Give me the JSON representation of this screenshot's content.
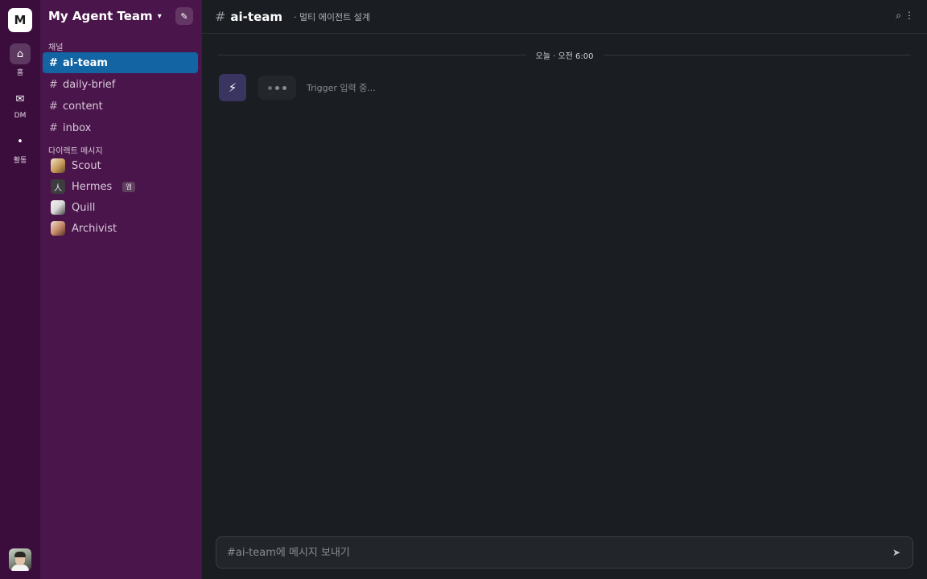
{
  "rail": {
    "workspace_initial": "M",
    "items": [
      {
        "icon": "home-icon",
        "glyph": "⌂",
        "label": "홈"
      },
      {
        "icon": "mail-icon",
        "glyph": "✉",
        "label": "DM"
      },
      {
        "icon": "activity-icon",
        "glyph": "•",
        "label": "활동"
      }
    ]
  },
  "sidebar": {
    "workspace_name": "My Agent Team",
    "caret": "▾",
    "compose_glyph": "✎",
    "channels_title": "채널",
    "channels": [
      {
        "hash": "#",
        "name": "ai-team"
      },
      {
        "hash": "#",
        "name": "daily-brief"
      },
      {
        "hash": "#",
        "name": "content"
      },
      {
        "hash": "#",
        "name": "inbox"
      }
    ],
    "dm_title": "다이렉트 메시지",
    "dms": [
      {
        "name": "Scout"
      },
      {
        "name": "Hermes",
        "avatar_glyph": "人",
        "badge": "앱"
      },
      {
        "name": "Quill"
      },
      {
        "name": "Archivist"
      }
    ]
  },
  "main": {
    "hash": "#",
    "channel_name": "ai-team",
    "topic": "· 멀티 에이전트 설계",
    "search_glyph": "⌕",
    "more_glyph": "⋮",
    "date_label": "오늘 · 오전 6:00",
    "bot_glyph": "⚡",
    "typing_text": "Trigger 입력 중...",
    "composer_placeholder": "#ai-team에 메시지 보내기",
    "send_glyph": "➤"
  },
  "colors": {
    "rail_bg": "#3a0d3d",
    "sidebar_bg": "#4a154b",
    "active_channel": "#1264a3",
    "main_bg": "#1a1d21"
  }
}
